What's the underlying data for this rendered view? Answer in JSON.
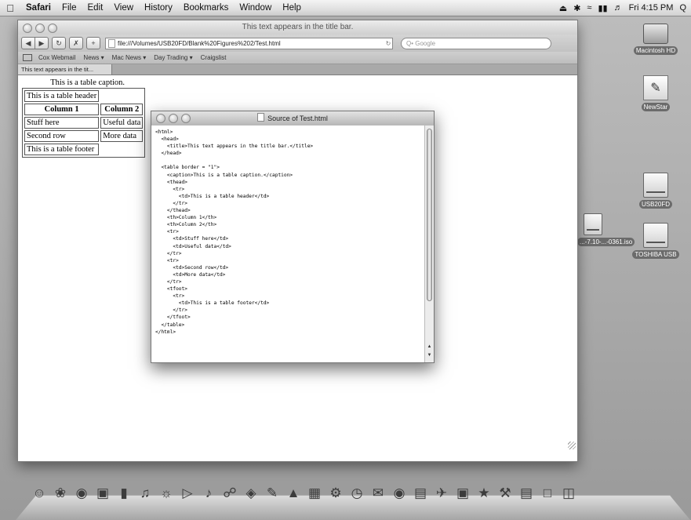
{
  "menubar": {
    "apple": "",
    "app_name": "Safari",
    "menus": [
      "File",
      "Edit",
      "View",
      "History",
      "Bookmarks",
      "Window",
      "Help"
    ],
    "clock": "Fri 4:15 PM",
    "spotlight": "Q"
  },
  "desktop": {
    "icons": [
      {
        "label": "Macintosh HD",
        "icon": "hard-disk-icon"
      },
      {
        "label": "NewStar",
        "icon": "app-icon"
      },
      {
        "label": "USB20FD",
        "icon": "usb-drive-icon"
      },
      {
        "label": "TOSHIBA USB",
        "icon": "usb-drive-icon"
      }
    ],
    "partial_icon_label": "...-7.10-...-0361.iso"
  },
  "safari": {
    "window_title": "This text appears in the title bar.",
    "address": "file:///Volumes/USB20FD/Blank%20Figures%202/Test.html",
    "search_placeholder": "Q• Google",
    "bookmarks": [
      "Cox Webmail",
      "News ▾",
      "Mac News ▾",
      "Day Trading ▾",
      "Craigslist"
    ],
    "tab_label": "This text appears in the tit...",
    "page": {
      "caption": "This is a table caption.",
      "header_row": "This is a table header",
      "columns": [
        "Column 1",
        "Column 2"
      ],
      "rows": [
        [
          "Stuff here",
          "Useful data"
        ],
        [
          "Second row",
          "More data"
        ]
      ],
      "footer": "This is a table footer"
    }
  },
  "source_window": {
    "title": "Source of Test.html",
    "code": "<html>\n  <head>\n    <title>This text appears in the title bar.</title>\n  </head>\n\n  <table border = \"1\">\n    <caption>This is a table caption.</caption>\n    <thead>\n      <tr>\n        <td>This is a table header</td>\n      </tr>\n    </thead>\n    <th>Column 1</th>\n    <th>Column 2</th>\n    <tr>\n      <td>Stuff here</td>\n      <td>Useful data</td>\n    </tr>\n    <tr>\n      <td>Second row</td>\n      <td>More data</td>\n    </tr>\n    <tfoot>\n      <tr>\n        <td>This is a table footer</td>\n      </tr>\n    </tfoot>\n  </table>\n</html>"
  },
  "dock": {
    "items": [
      "finder-icon",
      "dashboard-icon",
      "safari-icon",
      "preview-icon",
      "ibooks-icon",
      "itunes-icon",
      "iphoto-icon",
      "imovie-icon",
      "garageband-icon",
      "iweb-icon",
      "idvd-icon",
      "pages-icon",
      "keynote-icon",
      "numbers-icon",
      "system-preferences-icon",
      "time-machine-icon",
      "chat-icon",
      "photo-booth-icon",
      "address-book-icon",
      "mail-icon",
      "preview-icon",
      "app-store-icon",
      "trash-icon",
      "documents-icon",
      "downloads-icon",
      "trash-icon"
    ]
  }
}
